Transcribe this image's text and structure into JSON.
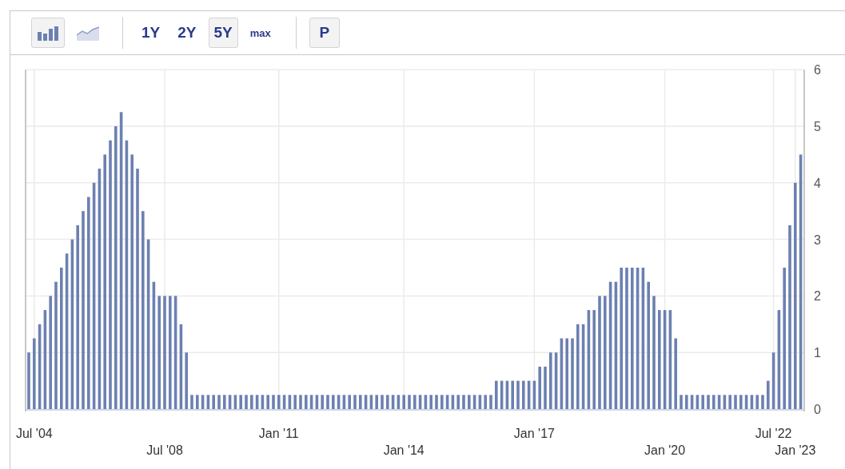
{
  "toolbar": {
    "chart_types": [
      {
        "kind": "bar",
        "selected": true
      },
      {
        "kind": "line",
        "selected": false
      }
    ],
    "ranges": [
      {
        "label": "1Y",
        "kind": "period",
        "selected": false
      },
      {
        "label": "2Y",
        "kind": "period",
        "selected": false
      },
      {
        "label": "5Y",
        "kind": "period",
        "selected": true
      },
      {
        "label": "max",
        "kind": "all",
        "selected": false
      }
    ],
    "p_button": {
      "label": "P"
    }
  },
  "chart": {
    "chart_data": {
      "type": "bar",
      "grid": true,
      "ylim": [
        0,
        6
      ],
      "categories": [
        null,
        "Jul '04",
        null,
        null,
        null,
        null,
        null,
        null,
        null,
        null,
        null,
        null,
        null,
        null,
        null,
        null,
        null,
        null,
        null,
        null,
        null,
        null,
        null,
        null,
        null,
        "Jul '08",
        null,
        null,
        null,
        null,
        null,
        null,
        null,
        null,
        null,
        null,
        null,
        null,
        null,
        null,
        null,
        null,
        null,
        null,
        null,
        null,
        "Jan '11",
        null,
        null,
        null,
        null,
        null,
        null,
        null,
        null,
        null,
        null,
        null,
        null,
        null,
        null,
        null,
        null,
        null,
        null,
        null,
        null,
        null,
        null,
        "Jan '14",
        null,
        null,
        null,
        null,
        null,
        null,
        null,
        null,
        null,
        null,
        null,
        null,
        null,
        null,
        null,
        null,
        null,
        null,
        null,
        null,
        null,
        null,
        null,
        "Jan '17",
        null,
        null,
        null,
        null,
        null,
        null,
        null,
        null,
        null,
        null,
        null,
        null,
        null,
        null,
        null,
        null,
        null,
        null,
        null,
        null,
        null,
        null,
        null,
        "Jan '20",
        null,
        null,
        null,
        null,
        null,
        null,
        null,
        null,
        null,
        null,
        null,
        null,
        null,
        null,
        null,
        null,
        null,
        null,
        null,
        "Jul '22",
        null,
        null,
        null,
        "Jan '23",
        null
      ],
      "yticks": [
        0,
        1,
        2,
        3,
        4,
        5,
        6
      ],
      "series": [
        {
          "color": "#6c80b1",
          "values": [
            1,
            1.25,
            1.5,
            1.75,
            2,
            2.25,
            2.5,
            2.75,
            3,
            3.25,
            3.5,
            3.75,
            4,
            4.25,
            4.5,
            4.75,
            5,
            5.25,
            4.75,
            4.5,
            4.25,
            3.5,
            3,
            2.25,
            2,
            2,
            2,
            2,
            1.5,
            1,
            0.25,
            0.25,
            0.25,
            0.25,
            0.25,
            0.25,
            0.25,
            0.25,
            0.25,
            0.25,
            0.25,
            0.25,
            0.25,
            0.25,
            0.25,
            0.25,
            0.25,
            0.25,
            0.25,
            0.25,
            0.25,
            0.25,
            0.25,
            0.25,
            0.25,
            0.25,
            0.25,
            0.25,
            0.25,
            0.25,
            0.25,
            0.25,
            0.25,
            0.25,
            0.25,
            0.25,
            0.25,
            0.25,
            0.25,
            0.25,
            0.25,
            0.25,
            0.25,
            0.25,
            0.25,
            0.25,
            0.25,
            0.25,
            0.25,
            0.25,
            0.25,
            0.25,
            0.25,
            0.25,
            0.25,
            0.25,
            0.5,
            0.5,
            0.5,
            0.5,
            0.5,
            0.5,
            0.5,
            0.5,
            0.75,
            0.75,
            1,
            1,
            1.25,
            1.25,
            1.25,
            1.5,
            1.5,
            1.75,
            1.75,
            2,
            2,
            2.25,
            2.25,
            2.5,
            2.5,
            2.5,
            2.5,
            2.5,
            2.25,
            2,
            1.75,
            1.75,
            1.75,
            1.25,
            0.25,
            0.25,
            0.25,
            0.25,
            0.25,
            0.25,
            0.25,
            0.25,
            0.25,
            0.25,
            0.25,
            0.25,
            0.25,
            0.25,
            0.25,
            0.25,
            0.5,
            1,
            1.75,
            2.5,
            3.25,
            4,
            4.5
          ]
        }
      ]
    }
  }
}
